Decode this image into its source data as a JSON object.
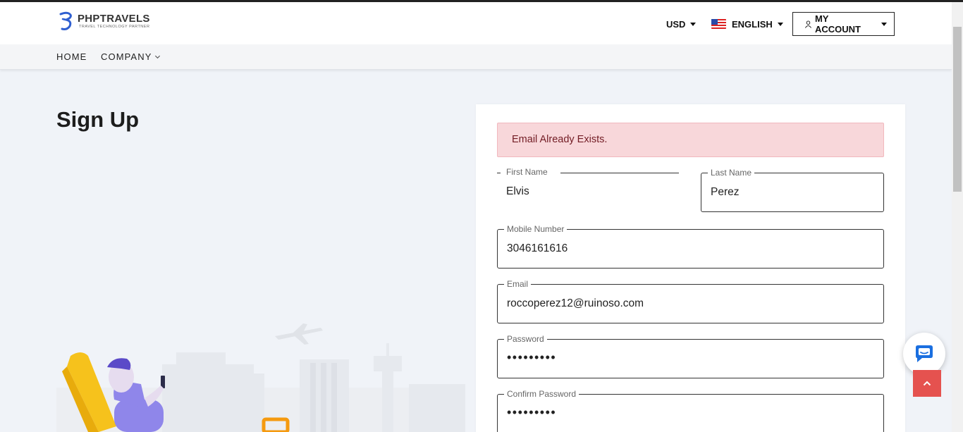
{
  "header": {
    "logo_title": "PHPTRAVELS",
    "logo_subtitle": "TRAVEL TECHNOLOGY PARTNER",
    "currency": "USD",
    "language": "ENGLISH",
    "account": "MY ACCOUNT"
  },
  "nav": {
    "home": "HOME",
    "company": "COMPANY"
  },
  "page": {
    "title": "Sign Up"
  },
  "form": {
    "alert": "Email Already Exists.",
    "first_name": {
      "label": "First Name",
      "value": "Elvis"
    },
    "last_name": {
      "label": "Last Name",
      "value": "Perez"
    },
    "mobile": {
      "label": "Mobile Number",
      "value": "3046161616"
    },
    "email": {
      "label": "Email",
      "value": "roccoperez12@ruinoso.com"
    },
    "password": {
      "label": "Password",
      "value": "•••••••••"
    },
    "confirm_password": {
      "label": "Confirm Password",
      "value": "•••••••••"
    }
  },
  "icons": {
    "logo": "phptravels-logo-icon",
    "flag": "us-flag-icon",
    "user": "user-icon",
    "chat": "chat-icon",
    "back_to_top": "chevron-up-icon"
  },
  "colors": {
    "alert_bg": "#f8d7da",
    "alert_text": "#721c24",
    "back_to_top": "#e5524f",
    "chat_icon": "#1a6fe0",
    "logo_blue": "#2f5fd0"
  }
}
